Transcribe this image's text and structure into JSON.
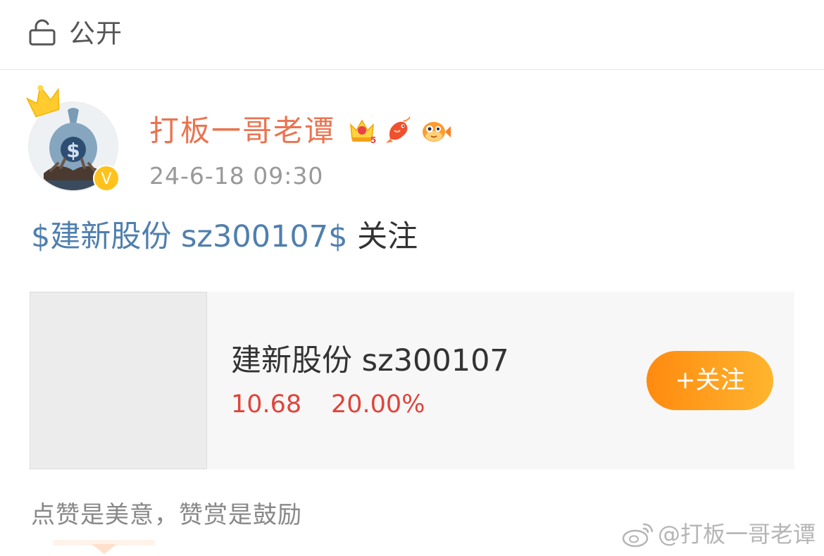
{
  "visibility": {
    "icon": "unlock-icon",
    "label": "公开"
  },
  "post": {
    "author": {
      "name": "打板一哥老谭",
      "avatar_icon": "money-bag-avatar",
      "crown_icon": "crown-icon",
      "verified_icon": "verified-v-icon",
      "verified_label": "V",
      "badges": [
        "vip-crown-badge-icon",
        "koi-fish-badge-icon",
        "pufferfish-badge-icon"
      ],
      "colors": {
        "name": "#eb7350"
      }
    },
    "timestamp": "24-6-18 09:30",
    "text": {
      "link": "$建新股份 sz300107$",
      "rest": " 关注"
    },
    "colors": {
      "link": "#4f7fae"
    }
  },
  "stock_card": {
    "name": "建新股份 sz300107",
    "price": "10.68",
    "change": "20.00%",
    "follow_button": "+关注",
    "colors": {
      "price": "#e0443c",
      "button_start": "#ff8a10",
      "button_end": "#ffb52e"
    }
  },
  "reward": {
    "text": "点赞是美意，赞赏是鼓励"
  },
  "watermark": {
    "icon": "weibo-icon",
    "text": "@打板一哥老谭"
  }
}
